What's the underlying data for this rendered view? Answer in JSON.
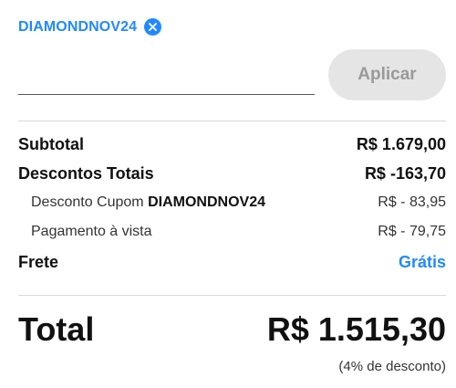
{
  "coupon": {
    "code": "DIAMONDNOV24",
    "remove_icon": "close-circle-icon",
    "accent_color": "#2189ff"
  },
  "coupon_form": {
    "input_value": "",
    "apply_label": "Aplicar"
  },
  "summary": {
    "subtotal_label": "Subtotal",
    "subtotal_value": "R$ 1.679,00",
    "discounts_label": "Descontos Totais",
    "discounts_value": "R$ -163,70",
    "coupon_discount_prefix": "Desconto Cupom",
    "coupon_discount_code": "DIAMONDNOV24",
    "coupon_discount_value": "R$ - 83,95",
    "cash_discount_label": "Pagamento à vista",
    "cash_discount_value": "R$ - 79,75",
    "shipping_label": "Frete",
    "shipping_value": "Grátis"
  },
  "total": {
    "label": "Total",
    "value": "R$ 1.515,30",
    "discount_note": "(4% de desconto)"
  }
}
